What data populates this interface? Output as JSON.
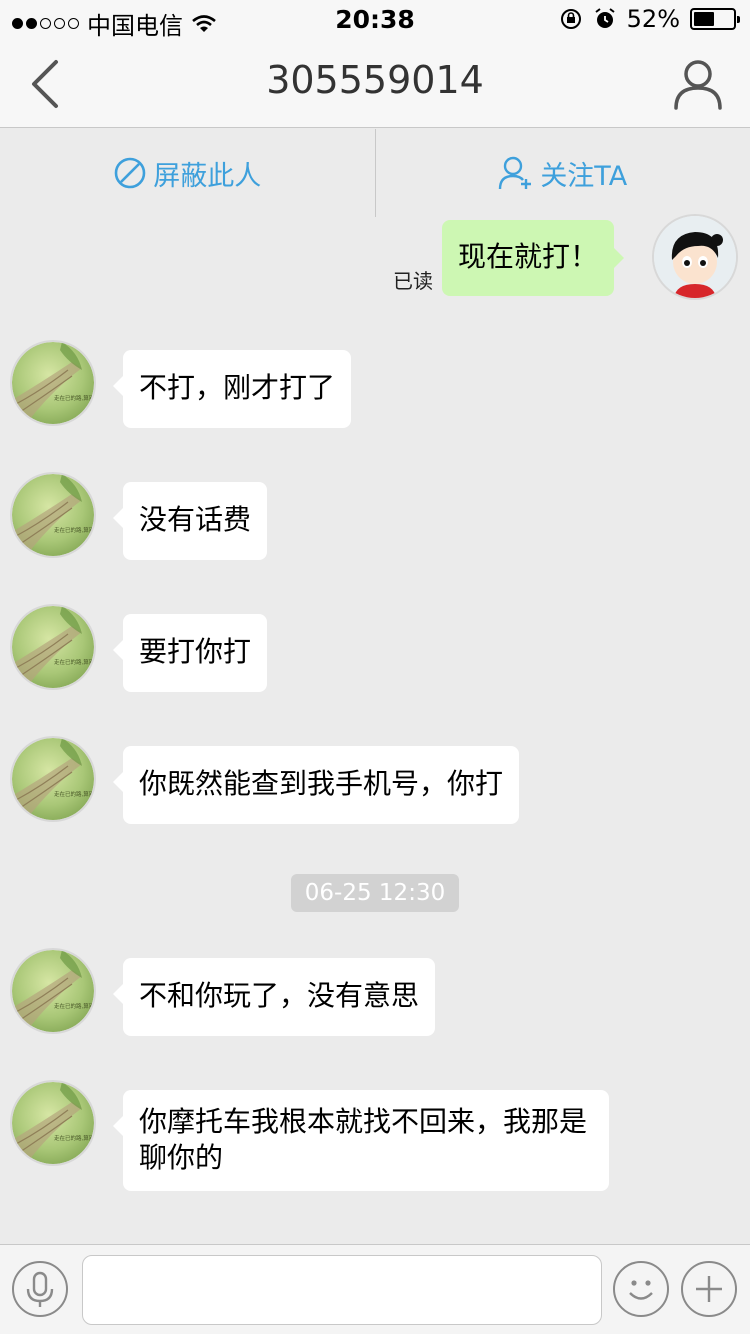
{
  "status_bar": {
    "carrier": "中国电信",
    "signal_strength": 2,
    "signal_max": 5,
    "time": "20:38",
    "battery_percent": "52%",
    "battery_level": 0.52
  },
  "nav": {
    "title": "305559014"
  },
  "actions": {
    "block_label": "屏蔽此人",
    "follow_label": "关注TA"
  },
  "messages": {
    "outgoing": {
      "text": "现在就打！",
      "read_status": "已读"
    },
    "incoming": [
      {
        "text": "不打，刚才打了"
      },
      {
        "text": "没有话费"
      },
      {
        "text": "要打你打"
      },
      {
        "text": "你既然能查到我手机号，你打"
      },
      {
        "text": "不和你玩了，没有意思"
      },
      {
        "text": "你摩托车我根本就找不回来，我那是聊你的"
      }
    ],
    "timestamp": "06-25 12:30",
    "avatar_caption": "走在已的路,算别"
  },
  "input": {
    "placeholder": "",
    "value": ""
  },
  "colors": {
    "accent": "#3ea0dc",
    "outgoing_bubble": "#cdf7b3",
    "incoming_bubble": "#ffffff",
    "background": "#ebebeb"
  },
  "icons": {
    "back": "chevron-left-icon",
    "profile": "person-icon",
    "block": "block-icon",
    "follow": "add-person-icon",
    "voice": "microphone-icon",
    "emoji": "smiley-icon",
    "more": "plus-icon"
  }
}
